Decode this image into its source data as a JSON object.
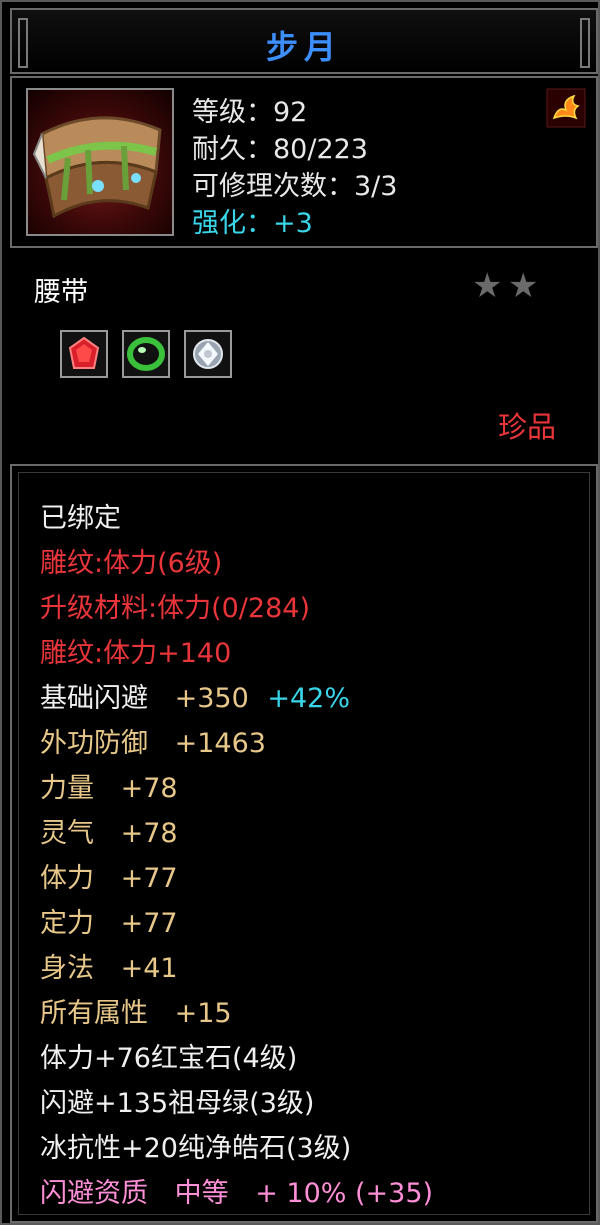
{
  "item": {
    "name": "步月",
    "level_label": "等级：92",
    "durability_label": "耐久：80/223",
    "repair_label": "可修理次数：3/3",
    "enhance_label": "强化：+3",
    "type": "腰带",
    "rarity": "珍品",
    "stars": [
      "★",
      "★"
    ],
    "gems": [
      "ruby-gem-icon",
      "emerald-gem-icon",
      "diamond-gem-icon"
    ]
  },
  "attributes": {
    "bound": "已绑定",
    "engraving": "雕纹:体力(6级)",
    "upgrade_material": "升级材料:体力(0/284)",
    "engraving_bonus": "雕纹:体力+140",
    "dodge_label": "基础闪避",
    "dodge_value": "+350",
    "dodge_pct": "+42%",
    "defense_label": "外功防御",
    "defense_value": "+1463",
    "str_label": "力量",
    "str_value": "+78",
    "spirit_label": "灵气",
    "spirit_value": "+78",
    "vit_label": "体力",
    "vit_value": "+77",
    "focus_label": "定力",
    "focus_value": "+77",
    "agility_label": "身法",
    "agility_value": "+41",
    "all_label": "所有属性",
    "all_value": "+15",
    "gem1": "体力+76红宝石(4级)",
    "gem2": "闪避+135祖母绿(3级)",
    "gem3": "冰抗性+20纯净皓石(3级)",
    "aptitude_label": "闪避资质",
    "aptitude_grade": "中等",
    "aptitude_value": "+ 10% (+35)"
  },
  "colors": {
    "title": "#3d8fff",
    "red": "#e8353a",
    "gold": "#e8c88a",
    "cyan": "#39d6ea",
    "pink": "#ff8fd6"
  }
}
